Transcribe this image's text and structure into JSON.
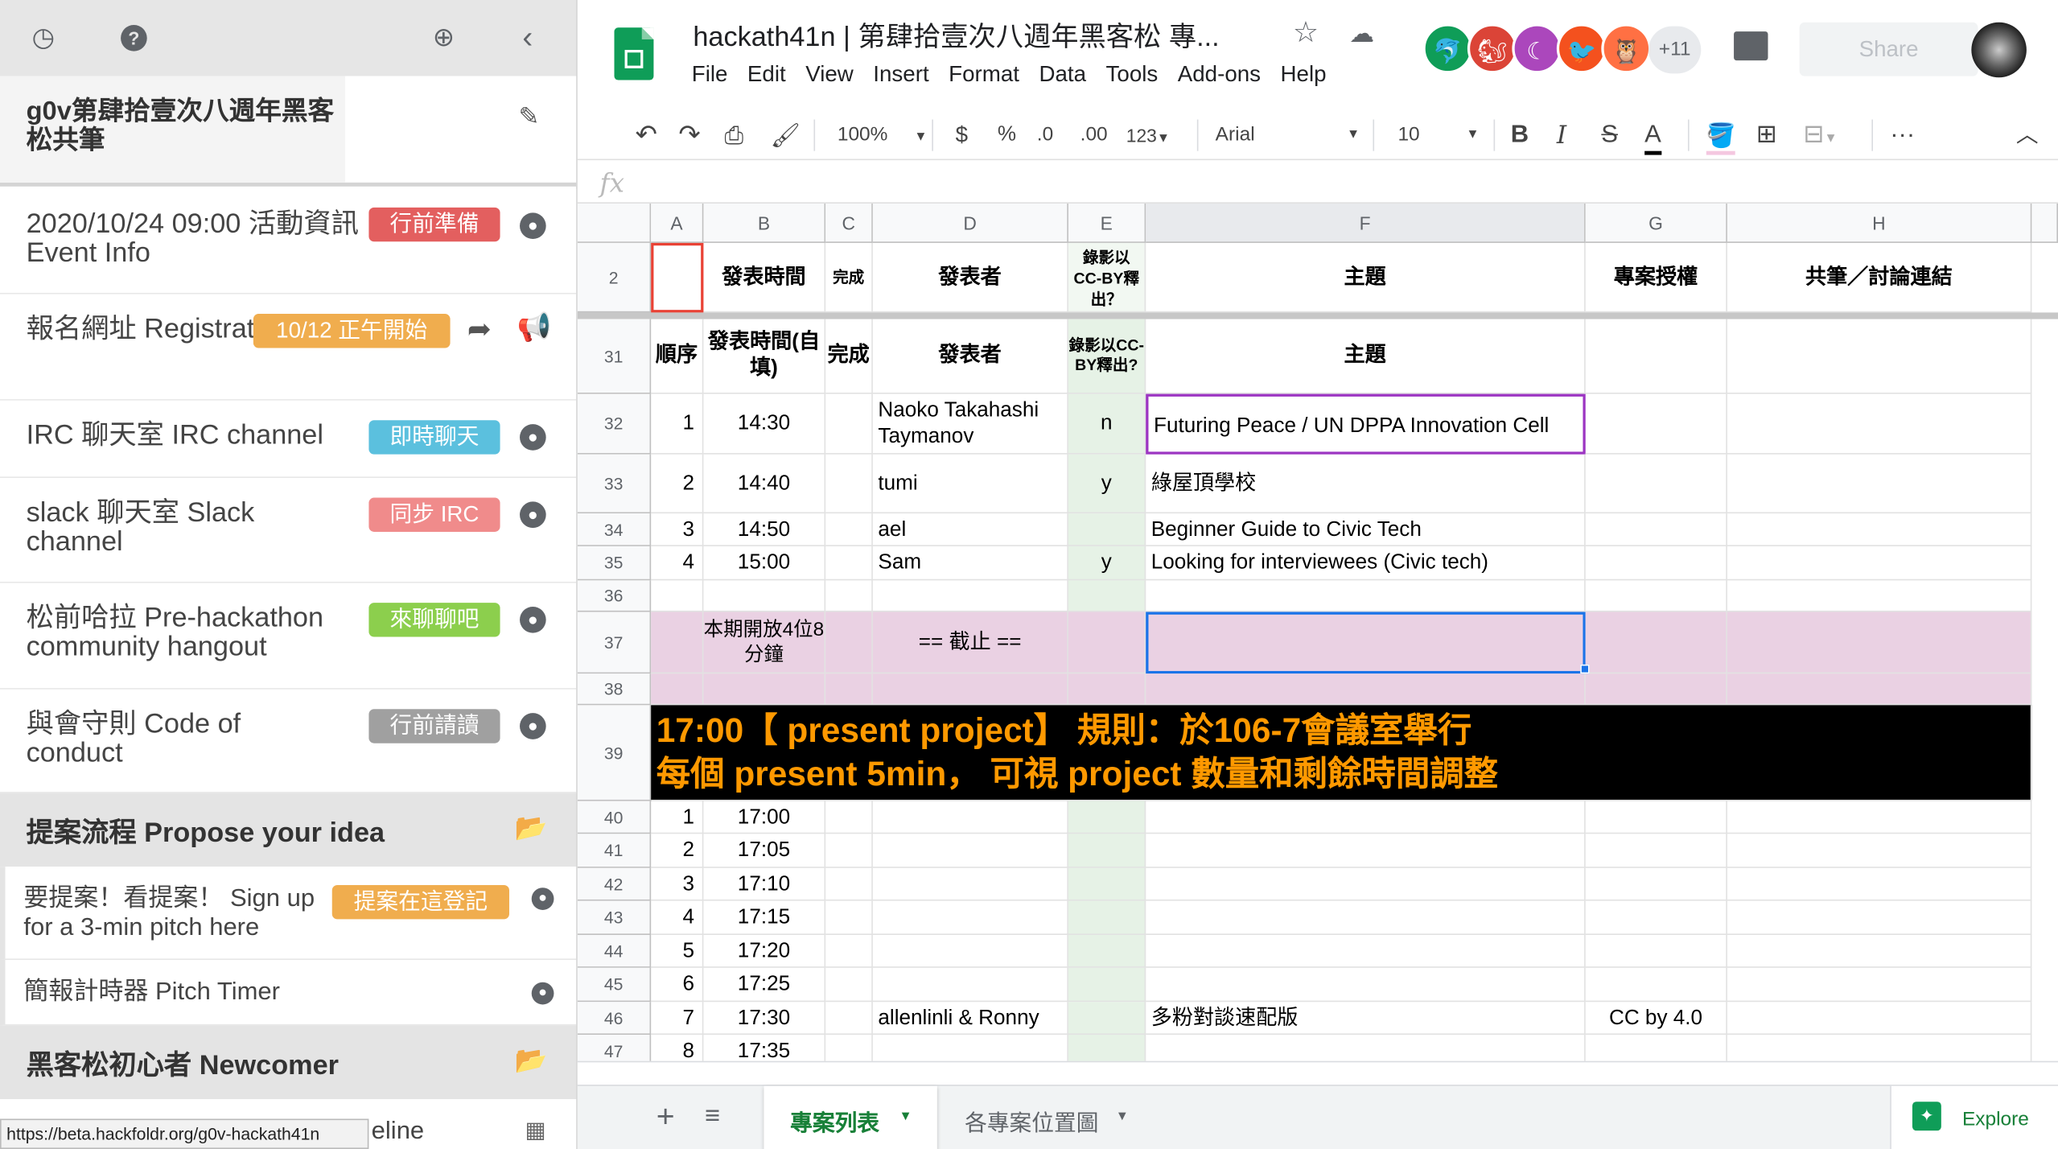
{
  "sidebar": {
    "title": "g0v第肆拾壹次八週年黑客松共筆",
    "items": [
      {
        "label": "2020/10/24 09:00 活動資訊 Event Info",
        "badge": "行前準備",
        "badge_color": "#e35f5f"
      },
      {
        "label": "報名網址 Registration",
        "badge": "10/12 正午開始",
        "badge_color": "#f0ad4e"
      },
      {
        "label": "IRC 聊天室 IRC channel",
        "badge": "即時聊天",
        "badge_color": "#5bc0de"
      },
      {
        "label": "slack 聊天室 Slack channel",
        "badge": "同步 IRC",
        "badge_color": "#f08b8b"
      },
      {
        "label": "松前哈拉 Pre-hackathon community hangout",
        "badge": "來聊聊吧",
        "badge_color": "#8ccf4d"
      },
      {
        "label": "與會守則 Code of conduct",
        "badge": "行前請讀",
        "badge_color": "#a0a0a0"
      }
    ],
    "section1": "提案流程 Propose your idea",
    "section1_items": [
      {
        "label": "要提案！看提案！ Sign up for a 3-min pitch here",
        "badge": "提案在這登記",
        "badge_color": "#f0ad4e"
      },
      {
        "label": "簡報計時器 Pitch Timer"
      }
    ],
    "section2": "黑客松初心者 Newcomer",
    "partial_item": "eline",
    "status_url": "https://beta.hackfoldr.org/g0v-hackath41n"
  },
  "sheets": {
    "doc_title": "hackath41n | 第肆拾壹次八週年黑客松 專...",
    "menu": [
      "File",
      "Edit",
      "View",
      "Insert",
      "Format",
      "Data",
      "Tools",
      "Add-ons",
      "Help"
    ],
    "more_collaborators": "+11",
    "share": "Share",
    "toolbar": {
      "zoom": "100%",
      "currency": "$",
      "percent": "%",
      "dec_less": ".0",
      "dec_more": ".00",
      "format": "123",
      "font": "Arial",
      "font_size": "10",
      "bold": "B",
      "italic": "I",
      "strike": "S",
      "color": "A"
    },
    "fx": "fx",
    "columns": [
      "A",
      "B",
      "C",
      "D",
      "E",
      "F",
      "G",
      "H"
    ],
    "frozen_header": {
      "row": "2",
      "cells": [
        "",
        "發表時間",
        "完成",
        "發表者",
        "錄影以CC-BY釋出？",
        "主題",
        "專案授權",
        "共筆／討論連結"
      ]
    },
    "rows": [
      {
        "n": "31",
        "cells": [
          "順序",
          "發表時間(自填)",
          "完成",
          "發表者",
          "錄影以CC-BY釋出?",
          "主題",
          "",
          ""
        ]
      },
      {
        "n": "32",
        "cells": [
          "1",
          "14:30",
          "",
          "Naoko Takahashi Taymanov",
          "n",
          "Futuring Peace / UN DPPA Innovation Cell",
          "",
          ""
        ]
      },
      {
        "n": "33",
        "cells": [
          "2",
          "14:40",
          "",
          "tumi",
          "y",
          "綠屋頂學校",
          "",
          ""
        ]
      },
      {
        "n": "34",
        "cells": [
          "3",
          "14:50",
          "",
          "ael",
          "",
          "Beginner Guide to Civic Tech",
          "",
          ""
        ]
      },
      {
        "n": "35",
        "cells": [
          "4",
          "15:00",
          "",
          "Sam",
          "y",
          "Looking for interviewees (Civic tech)",
          "",
          ""
        ]
      },
      {
        "n": "36",
        "cells": [
          "",
          "",
          "",
          "",
          "",
          "",
          "",
          ""
        ]
      },
      {
        "n": "37",
        "cells": [
          "",
          "本期開放4位8分鐘",
          "",
          "== 截止 ==",
          "",
          "",
          "",
          ""
        ]
      },
      {
        "n": "38",
        "cells": [
          "",
          "",
          "",
          "",
          "",
          "",
          "",
          ""
        ]
      },
      {
        "n": "39",
        "banner": "17:00【 present project】 規則：於106-7會議室舉行\n每個 present 5min， 可視 project 數量和剩餘時間調整"
      },
      {
        "n": "40",
        "cells": [
          "1",
          "17:00",
          "",
          "",
          "",
          "",
          "",
          ""
        ]
      },
      {
        "n": "41",
        "cells": [
          "2",
          "17:05",
          "",
          "",
          "",
          "",
          "",
          ""
        ]
      },
      {
        "n": "42",
        "cells": [
          "3",
          "17:10",
          "",
          "",
          "",
          "",
          "",
          ""
        ]
      },
      {
        "n": "43",
        "cells": [
          "4",
          "17:15",
          "",
          "",
          "",
          "",
          "",
          ""
        ]
      },
      {
        "n": "44",
        "cells": [
          "5",
          "17:20",
          "",
          "",
          "",
          "",
          "",
          ""
        ]
      },
      {
        "n": "45",
        "cells": [
          "6",
          "17:25",
          "",
          "",
          "",
          "",
          "",
          ""
        ]
      },
      {
        "n": "46",
        "cells": [
          "7",
          "17:30",
          "",
          "allenlinli & Ronny",
          "",
          "多粉對談速配版",
          "CC by 4.0",
          ""
        ]
      },
      {
        "n": "47",
        "cells": [
          "8",
          "17:35",
          "",
          "",
          "",
          "",
          "",
          ""
        ]
      }
    ],
    "tabs": [
      "專案列表",
      "各專案位置圖"
    ],
    "explore": "Explore"
  }
}
